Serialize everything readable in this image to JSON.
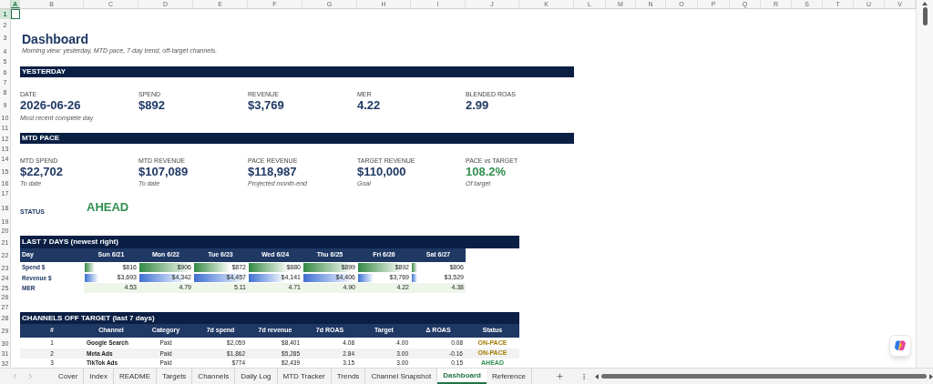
{
  "column_headers": [
    {
      "label": "A",
      "selected": true
    },
    {
      "label": "B",
      "selected": false
    },
    {
      "label": "C",
      "selected": false
    },
    {
      "label": "D",
      "selected": false
    },
    {
      "label": "E",
      "selected": false
    },
    {
      "label": "F",
      "selected": false
    },
    {
      "label": "G",
      "selected": false
    },
    {
      "label": "H",
      "selected": false
    },
    {
      "label": "I",
      "selected": false
    },
    {
      "label": "J",
      "selected": false
    },
    {
      "label": "K",
      "selected": false
    },
    {
      "label": "L",
      "selected": false
    },
    {
      "label": "M",
      "selected": false
    },
    {
      "label": "N",
      "selected": false
    },
    {
      "label": "O",
      "selected": false
    },
    {
      "label": "P",
      "selected": false
    },
    {
      "label": "Q",
      "selected": false
    },
    {
      "label": "R",
      "selected": false
    },
    {
      "label": "S",
      "selected": false
    },
    {
      "label": "T",
      "selected": false
    },
    {
      "label": "U",
      "selected": false
    },
    {
      "label": "V",
      "selected": false
    }
  ],
  "row_numbers": [
    {
      "label": "1",
      "selected": true
    },
    {
      "label": "2",
      "selected": false
    },
    {
      "label": "3",
      "selected": false
    },
    {
      "label": "4",
      "selected": false
    },
    {
      "label": "5",
      "selected": false
    },
    {
      "label": "6",
      "selected": false
    },
    {
      "label": "7",
      "selected": false
    },
    {
      "label": "8",
      "selected": false
    },
    {
      "label": "9",
      "selected": false
    },
    {
      "label": "10",
      "selected": false
    },
    {
      "label": "11",
      "selected": false
    },
    {
      "label": "12",
      "selected": false
    },
    {
      "label": "13",
      "selected": false
    },
    {
      "label": "14",
      "selected": false
    },
    {
      "label": "15",
      "selected": false
    },
    {
      "label": "16",
      "selected": false
    },
    {
      "label": "17",
      "selected": false
    },
    {
      "label": "18",
      "selected": false
    },
    {
      "label": "19",
      "selected": false
    },
    {
      "label": "20",
      "selected": false
    },
    {
      "label": "21",
      "selected": false
    },
    {
      "label": "22",
      "selected": false
    },
    {
      "label": "23",
      "selected": false
    },
    {
      "label": "24",
      "selected": false
    },
    {
      "label": "25",
      "selected": false
    },
    {
      "label": "26",
      "selected": false
    },
    {
      "label": "27",
      "selected": false
    },
    {
      "label": "28",
      "selected": false
    },
    {
      "label": "29",
      "selected": false
    },
    {
      "label": "30",
      "selected": false
    },
    {
      "label": "31",
      "selected": false
    },
    {
      "label": "32",
      "selected": false
    }
  ],
  "title": "Dashboard",
  "subtitle": "Morning view: yesterday, MTD pace, 7-day trend, off-target channels.",
  "yesterday": {
    "heading": "YESTERDAY",
    "kpis": [
      {
        "label": "DATE",
        "value": "2026-06-26",
        "note": "Most recent complete day",
        "color": "#1f3864"
      },
      {
        "label": "SPEND",
        "value": "$892",
        "color": "#1f3864"
      },
      {
        "label": "REVENUE",
        "value": "$3,769",
        "color": "#1f3864"
      },
      {
        "label": "MER",
        "value": "4.22",
        "color": "#1f3864"
      },
      {
        "label": "BLENDED ROAS",
        "value": "2.99",
        "color": "#1f3864"
      }
    ]
  },
  "mtd_pace": {
    "heading": "MTD PACE",
    "kpis": [
      {
        "label": "MTD SPEND",
        "value": "$22,702",
        "note": "To date",
        "color": "#1f3864"
      },
      {
        "label": "MTD REVENUE",
        "value": "$107,089",
        "note": "To date",
        "color": "#1f3864"
      },
      {
        "label": "PACE REVENUE",
        "value": "$118,987",
        "note": "Projected month-end",
        "color": "#1f3864"
      },
      {
        "label": "TARGET REVENUE",
        "value": "$110,000",
        "note": "Goal",
        "color": "#1f3864"
      },
      {
        "label": "PACE vs TARGET",
        "value": "108.2%",
        "note": "Of target",
        "color": "#2f8f4e"
      }
    ]
  },
  "status": {
    "label": "STATUS",
    "value": "AHEAD",
    "color": "#2f8f4e"
  },
  "last_7_days": {
    "heading": "LAST 7 DAYS (newest right)",
    "columns": [
      "Day",
      "Sun 6/21",
      "Mon 6/22",
      "Tue 6/23",
      "Wed 6/24",
      "Thu 6/25",
      "Fri 6/26",
      "Sat 6/27"
    ],
    "rows": [
      {
        "label": "Spend $",
        "kind": "green_bar",
        "cells": [
          {
            "value": "$816",
            "level": 0.19
          },
          {
            "value": "$906",
            "level": 1
          },
          {
            "value": "$872",
            "level": 0.69
          },
          {
            "value": "$880",
            "level": 0.77
          },
          {
            "value": "$899",
            "level": 0.94
          },
          {
            "value": "$892",
            "level": 0.87
          },
          {
            "value": "$806",
            "level": 0.1
          }
        ]
      },
      {
        "label": "Revenue $",
        "kind": "blue_bar",
        "cells": [
          {
            "value": "$3,693",
            "level": 0.26
          },
          {
            "value": "$4,342",
            "level": 0.89
          },
          {
            "value": "$4,457",
            "level": 1
          },
          {
            "value": "$4,141",
            "level": 0.69
          },
          {
            "value": "$4,406",
            "level": 0.95
          },
          {
            "value": "$3,769",
            "level": 0.3
          },
          {
            "value": "$3,529",
            "level": 0.1
          }
        ]
      },
      {
        "label": "MER",
        "kind": "shaded",
        "cells": [
          {
            "value": "4.53"
          },
          {
            "value": "4.79"
          },
          {
            "value": "5.11"
          },
          {
            "value": "4.71"
          },
          {
            "value": "4.90"
          },
          {
            "value": "4.22"
          },
          {
            "value": "4.38"
          }
        ]
      }
    ]
  },
  "channels": {
    "heading": "CHANNELS OFF TARGET  (last 7 days)",
    "columns": [
      "#",
      "Channel",
      "Category",
      "7d spend",
      "7d revenue",
      "7d ROAS",
      "Target",
      "Δ ROAS",
      "Status"
    ],
    "rows": [
      {
        "num": "1",
        "channel": "Google Search",
        "category": "Paid",
        "spend": "$2,059",
        "revenue": "$8,401",
        "roas": "4.08",
        "target": "4.00",
        "delta": "0.08",
        "status": "ON-PACE",
        "color": "#a37c00"
      },
      {
        "num": "2",
        "channel": "Meta Ads",
        "category": "Paid",
        "spend": "$1,862",
        "revenue": "$5,285",
        "roas": "2.84",
        "target": "3.00",
        "delta": "-0.16",
        "status": "ON-PACE",
        "color": "#a37c00"
      },
      {
        "num": "3",
        "channel": "TikTok Ads",
        "category": "Paid",
        "spend": "$774",
        "revenue": "$2,439",
        "roas": "3.15",
        "target": "3.00",
        "delta": "0.15",
        "status": "AHEAD",
        "color": "#2f8f4e"
      }
    ]
  },
  "sheet_tabs": [
    {
      "label": "Cover",
      "selected": false
    },
    {
      "label": "Index",
      "selected": false
    },
    {
      "label": "README",
      "selected": false
    },
    {
      "label": "Targets",
      "selected": false
    },
    {
      "label": "Channels",
      "selected": false
    },
    {
      "label": "Daily Log",
      "selected": false
    },
    {
      "label": "MTD Tracker",
      "selected": false
    },
    {
      "label": "Trends",
      "selected": false
    },
    {
      "label": "Channel Snapshot",
      "selected": false
    },
    {
      "label": "Dashboard",
      "selected": true
    },
    {
      "label": "Reference",
      "selected": false
    }
  ]
}
